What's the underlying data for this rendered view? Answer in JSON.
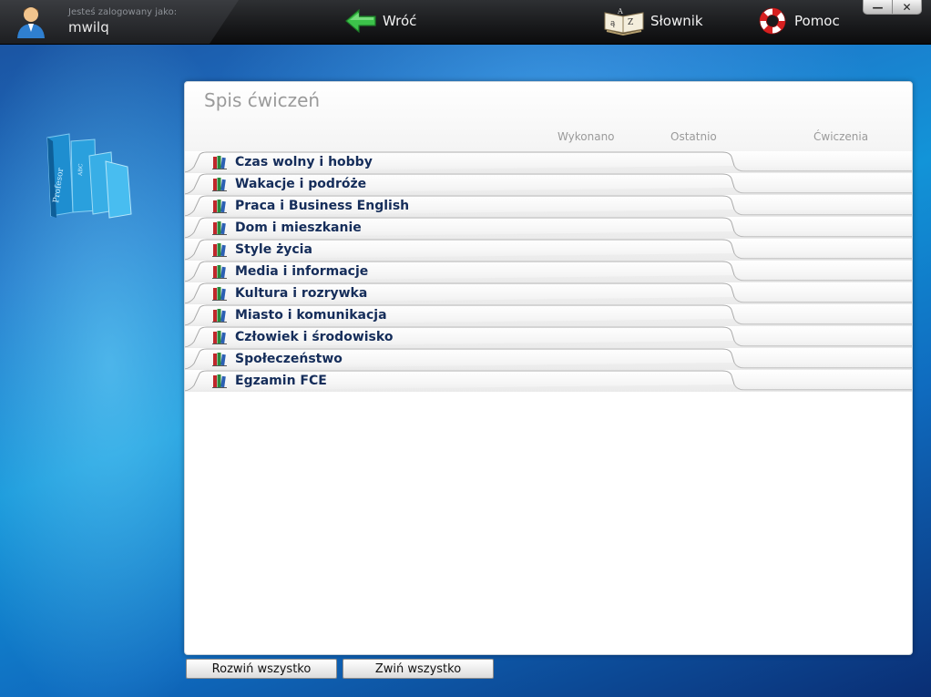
{
  "user": {
    "caption": "Jesteś zalogowany jako:",
    "name": "mwilq"
  },
  "nav": {
    "back_label": "Wróć",
    "dictionary_label": "Słownik",
    "help_label": "Pomoc"
  },
  "window_controls": {
    "minimize": "—",
    "close": "✕"
  },
  "panel": {
    "title": "Spis ćwiczeń",
    "columns": {
      "done": "Wykonano",
      "last": "Ostatnio",
      "exercises": "Ćwiczenia"
    },
    "topics": [
      {
        "label": "Czas wolny i hobby"
      },
      {
        "label": "Wakacje i podróże"
      },
      {
        "label": "Praca i Business English"
      },
      {
        "label": "Dom i mieszkanie"
      },
      {
        "label": "Style życia"
      },
      {
        "label": "Media i informacje"
      },
      {
        "label": "Kultura i rozrywka"
      },
      {
        "label": "Miasto i komunikacja"
      },
      {
        "label": "Człowiek i środowisko"
      },
      {
        "label": "Społeczeństwo"
      },
      {
        "label": "Egzamin FCE"
      }
    ]
  },
  "buttons": {
    "expand_all": "Rozwiń wszystko",
    "collapse_all": "Zwiń wszystko"
  },
  "icons": {
    "avatar": "user-avatar-icon",
    "back": "green-arrow-left-icon",
    "dictionary": "open-book-icon",
    "help": "lifebuoy-icon",
    "topic": "books-icon"
  },
  "colors": {
    "topbar": "#1a1b1d",
    "topic_text": "#152d5a",
    "accent_green": "#3cc24a",
    "background_blue": "#1294d8"
  }
}
